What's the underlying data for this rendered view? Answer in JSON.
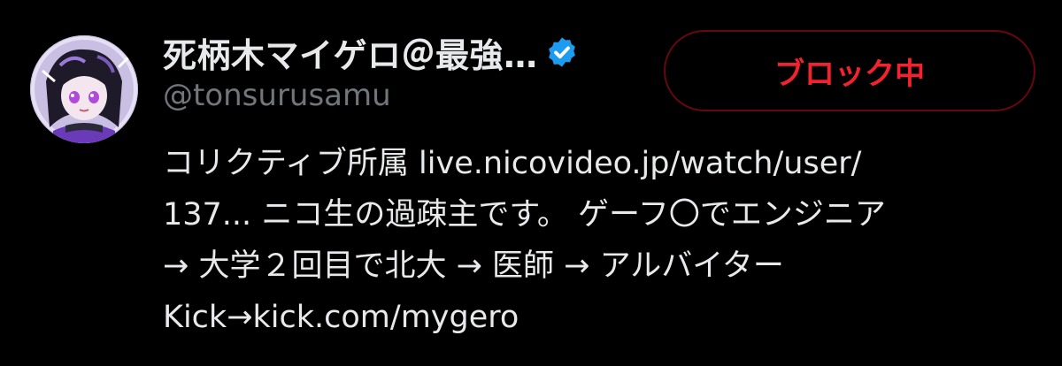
{
  "profile": {
    "display_name": "死柄木マイゲロ＠最強…",
    "handle": "@tonsurusamu",
    "verified_icon": "verified-badge-icon",
    "verified_color": "#1d9bf0"
  },
  "actions": {
    "block_label": "ブロック中",
    "block_color": "#f4212e"
  },
  "bio": {
    "line1_text": "コリクティブ所属 ",
    "line1_link": "live.nicovideo.jp/watch/user/",
    "line2_link": "137...",
    "line2_text": " ニコ生の過疎主です。 ゲーフ〇でエンジニア",
    "line3_text": "→ 大学２回目で北大 → 医師 → アルバイター",
    "line4_text": "Kick→",
    "line4_link": "kick.com/mygero"
  }
}
